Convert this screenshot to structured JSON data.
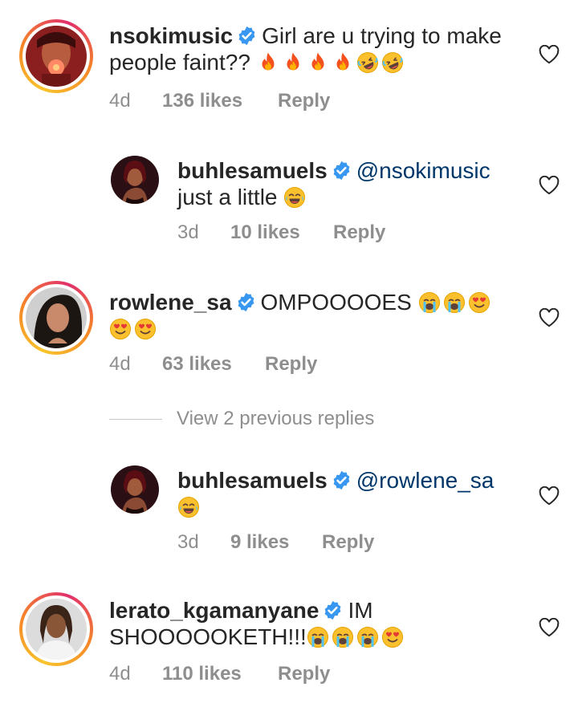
{
  "comments": [
    {
      "username": "nsokimusic",
      "text_line1": "Girl are u trying to make",
      "text_line2": "people faint??",
      "emojis": [
        "fire",
        "fire",
        "fire",
        "fire",
        "rofl",
        "rofl"
      ],
      "time": "4d",
      "likes": "136 likes",
      "reply": "Reply"
    },
    {
      "username": "buhlesamuels",
      "mention": "@nsokimusic",
      "text_line2": "just a little",
      "emojis": [
        "joy"
      ],
      "time": "3d",
      "likes": "10 likes",
      "reply": "Reply"
    },
    {
      "username": "rowlene_sa",
      "text_line1": "OMPOOOOES",
      "emojis": [
        "sob",
        "sob",
        "heart-eyes",
        "heart-eyes",
        "heart-eyes"
      ],
      "time": "4d",
      "likes": "63 likes",
      "reply": "Reply"
    },
    {
      "username": "buhlesamuels",
      "mention": "@rowlene_sa",
      "emojis": [
        "joy"
      ],
      "time": "3d",
      "likes": "9 likes",
      "reply": "Reply"
    },
    {
      "username": "lerato_kgamanyane",
      "text_line1": "IM",
      "text_line2": "SHOOOOOKETH!!!",
      "emojis": [
        "sob",
        "sob",
        "sob",
        "heart-eyes"
      ],
      "time": "4d",
      "likes": "110 likes",
      "reply": "Reply"
    }
  ],
  "view_previous_replies": "View 2 previous replies",
  "colors": {
    "text": "#262626",
    "secondary": "#8e8e8e",
    "mention": "#00376b",
    "verified": "#3897f0"
  },
  "icons": [
    "verified-badge-icon",
    "heart-outline-icon",
    "fire-emoji",
    "rofl-emoji",
    "joy-emoji",
    "sob-emoji",
    "heart-eyes-emoji"
  ]
}
